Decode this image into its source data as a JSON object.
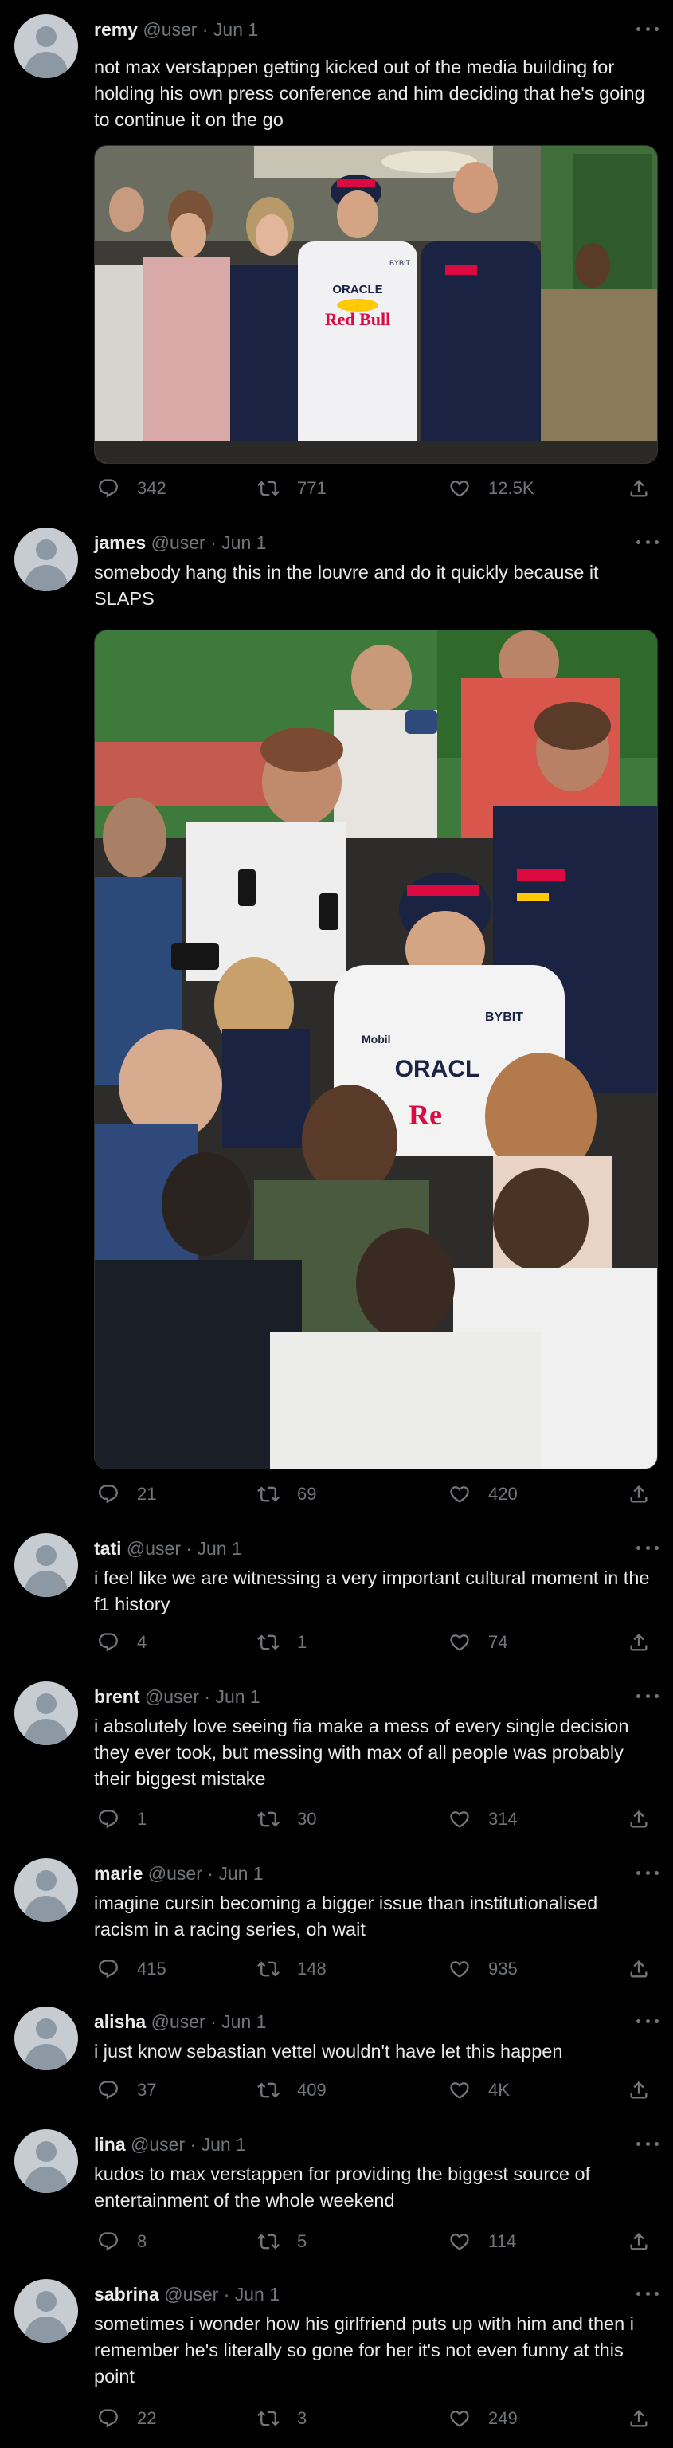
{
  "tweets": [
    {
      "name": "remy",
      "handle": "@user",
      "date": "Jun 1",
      "text": "not max verstappen getting kicked out of the media building for holding his own press conference and him deciding that he's going to continue it on the go",
      "replies": "342",
      "retweets": "771",
      "likes": "12.5K"
    },
    {
      "name": "james",
      "handle": "@user",
      "date": "Jun 1",
      "text": "somebody hang this in the louvre and do it quickly because it SLAPS",
      "replies": "21",
      "retweets": "69",
      "likes": "420"
    },
    {
      "name": "tati",
      "handle": "@user",
      "date": "Jun 1",
      "text": "i feel like we are witnessing a very important cultural moment in the f1 history",
      "replies": "4",
      "retweets": "1",
      "likes": "74"
    },
    {
      "name": "brent",
      "handle": "@user",
      "date": "Jun 1",
      "text": "i absolutely love seeing fia make a mess of every single decision they ever took, but messing with max of all people was probably their biggest mistake",
      "replies": "1",
      "retweets": "30",
      "likes": "314"
    },
    {
      "name": "marie",
      "handle": "@user",
      "date": "Jun 1",
      "text": "imagine cursin becoming a bigger issue than institutionalised racism in a racing series, oh wait",
      "replies": "415",
      "retweets": "148",
      "likes": "935"
    },
    {
      "name": "alisha",
      "handle": "@user",
      "date": "Jun 1",
      "text": "i just know sebastian vettel wouldn't have let this happen",
      "replies": "37",
      "retweets": "409",
      "likes": "4K"
    },
    {
      "name": "lina",
      "handle": "@user",
      "date": "Jun 1",
      "text": "kudos to max verstappen for providing the biggest source of entertainment of the whole weekend",
      "replies": "8",
      "retweets": "5",
      "likes": "114"
    },
    {
      "name": "sabrina",
      "handle": "@user",
      "date": "Jun 1",
      "text": "sometimes i wonder how his girlfriend puts up with him and then i remember he's literally so gone for her it's not even funny at this point",
      "replies": "22",
      "retweets": "3",
      "likes": "249"
    }
  ],
  "media_1": {
    "shirt_brand": "ORACLE",
    "shirt_team": "Red Bull",
    "shirt_sponsor": "BYBIT"
  },
  "media_2": {
    "shirt_brand": "ORACL",
    "shirt_team": "Re",
    "shirt_sponsor": "BYBIT",
    "sleeve_sponsor": "Mobil"
  },
  "icons": {
    "reply": "reply-icon",
    "retweet": "retweet-icon",
    "like": "heart-icon",
    "share": "share-icon",
    "more": "more-options-icon",
    "avatar": "default-avatar-icon"
  },
  "colors": {
    "background": "#000000",
    "text": "#e7e9ea",
    "muted": "#71767b",
    "border": "#2f3336",
    "redbull_navy": "#1b2342",
    "redbull_red": "#db0a40",
    "redbull_yellow": "#ffc906"
  }
}
